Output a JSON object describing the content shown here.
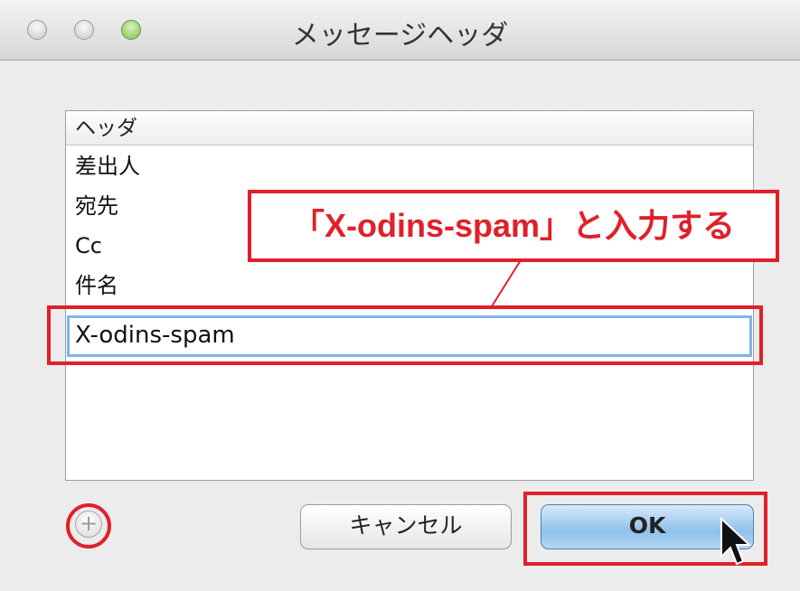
{
  "window": {
    "title": "メッセージヘッダ"
  },
  "list": {
    "column_header": "ヘッダ",
    "rows": [
      "差出人",
      "宛先",
      "Cc",
      "件名"
    ],
    "edit_value": "X-odins-spam"
  },
  "annotation": {
    "callout": "「X-odins-spam」と入力する",
    "color": "#e0202a"
  },
  "buttons": {
    "add": "+",
    "cancel": "キャンセル",
    "ok": "OK"
  }
}
